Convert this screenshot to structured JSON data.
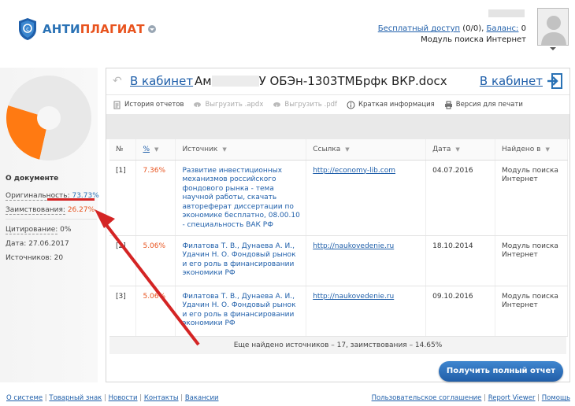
{
  "header": {
    "logo_text_a": "АНТИ",
    "logo_text_b": "ПЛАГИАТ",
    "free_access_label": "Бесплатный доступ",
    "free_access_count": "(0/0),",
    "balance_label": "Баланс:",
    "balance_value": "0",
    "module_label": "Модуль поиска Интернет"
  },
  "sidebar": {
    "pie": {
      "original_pct": 73.73,
      "borrowed_pct": 26.27,
      "colors": {
        "original": "#e8e8e8",
        "borrowed": "#ff7a12"
      }
    },
    "title": "О документе",
    "originality_label": "Оригинальность:",
    "originality_value": "73.73%",
    "borrowing_label": "Заимствования:",
    "borrowing_value": "26.27%",
    "citation_label": "Цитирование:",
    "citation_value": "0%",
    "date_label": "Дата:",
    "date_value": "27.06.2017",
    "sources_label": "Источников:",
    "sources_value": "20"
  },
  "panel": {
    "cabinet_link_left": "В кабинет",
    "doc_name_prefix": "Ам",
    "doc_name_suffix": "У ОБЭн-1303ТМБрфк ВКР.docx",
    "cabinet_link_right": "В кабинет",
    "toolbar": {
      "history": "История отчетов",
      "export_apdx": "Выгрузить .apdx",
      "export_pdf": "Выгрузить .pdf",
      "brief": "Краткая информация",
      "print": "Версия для печати"
    },
    "columns": {
      "num": "№",
      "pct": "%",
      "source": "Источник",
      "link": "Ссылка",
      "date": "Дата",
      "found_in": "Найдено в"
    },
    "rows": [
      {
        "num": "[1]",
        "pct": "7.36%",
        "source": "Развитие инвестиционных механизмов российского фондового рынка - тема научной работы, скачать автореферат диссертации по экономике бесплатно, 08.00.10 - специальность ВАК РФ",
        "link": "http://economy-lib.com",
        "date": "04.07.2016",
        "found_in": "Модуль поиска Интернет"
      },
      {
        "num": "[2]",
        "pct": "5.06%",
        "source": "Филатова Т. В., Дунаева А. И., Удачин Н. О. Фондовый рынок и его роль в финансировании экономики РФ",
        "link": "http://naukovedenie.ru",
        "date": "18.10.2014",
        "found_in": "Модуль поиска Интернет"
      },
      {
        "num": "[3]",
        "pct": "5.06%",
        "source": "Филатова Т. В., Дунаева А. И., Удачин Н. О. Фондовый рынок и его роль в финансировании экономики РФ",
        "link": "http://naukovedenie.ru",
        "date": "09.10.2016",
        "found_in": "Модуль поиска Интернет"
      }
    ],
    "more_note": "Еще найдено источников – 17, заимствования – 14.65%",
    "full_report_button": "Получить полный отчет"
  },
  "footer": {
    "about": "О системе",
    "trademark": "Товарный знак",
    "news": "Новости",
    "contacts": "Контакты",
    "jobs": "Вакансии",
    "agreement": "Пользовательское соглашение",
    "report_viewer": "Report Viewer",
    "help": "Помощь"
  }
}
